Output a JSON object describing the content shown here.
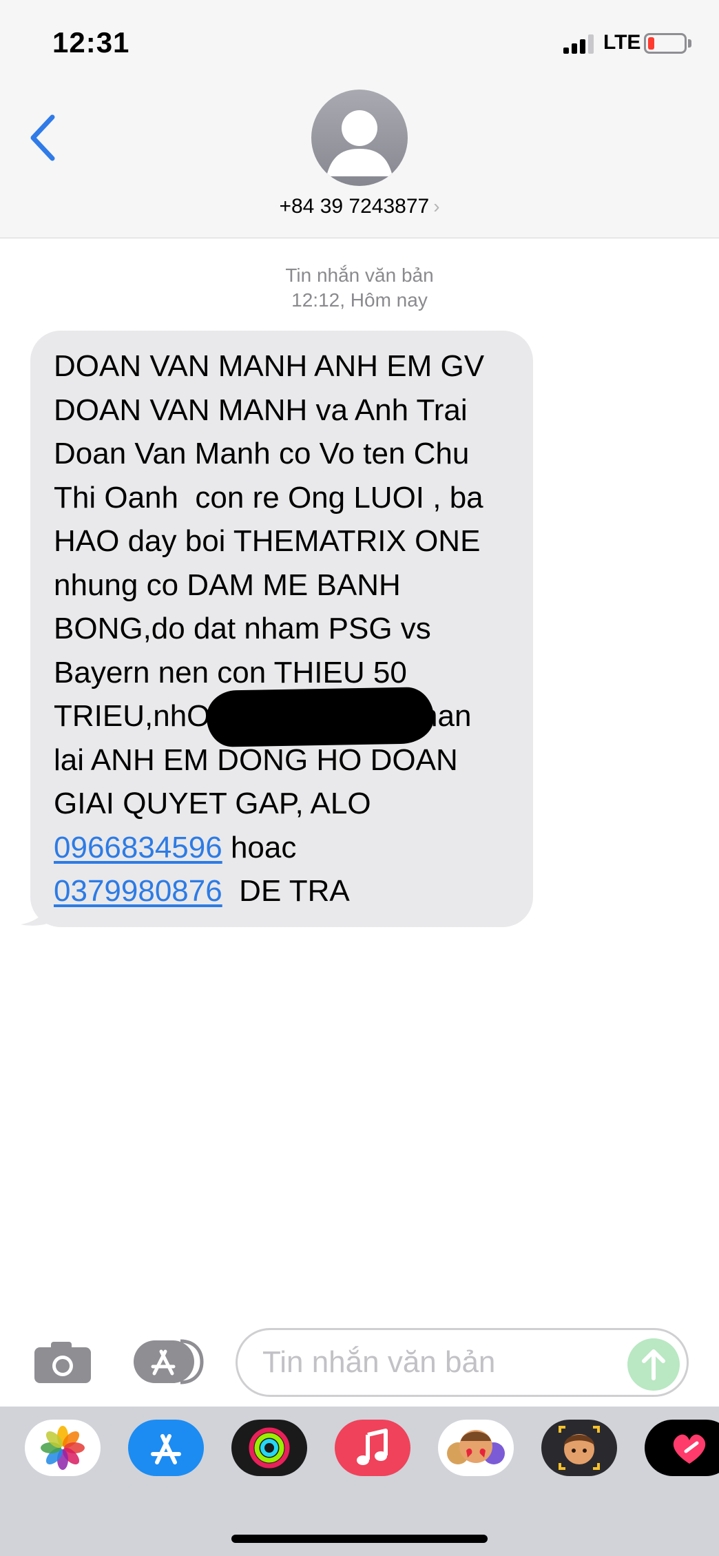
{
  "status_bar": {
    "time": "12:31",
    "network": "LTE"
  },
  "header": {
    "contact": "+84 39 7243877",
    "chevron": "›"
  },
  "conversation": {
    "service_label": "Tin nhắn văn bản",
    "timestamp": "12:12, Hôm nay",
    "message": {
      "lines": [
        "DOAN VAN MANH ANH EM GV",
        "DOAN VAN MANH va Anh Trai",
        "Doan Van Manh co Vo ten Chu",
        "Thi Oanh  con re Ong LUOI , ba",
        "HAO day boi THEMATRIX ONE",
        "nhung co DAM ME BANH",
        "BONG,do dat nham PSG vs",
        "Bayern nen con THIEU 50",
        "TRIEU,nhO                       nhan",
        "lai ANH EM DONG HO DOAN",
        "GIAI QUYET GAP, ALO"
      ],
      "phone_1": "0966834596",
      "connector": " hoac",
      "phone_2": "0379980876",
      "ending": "  DE TRA"
    }
  },
  "input_bar": {
    "placeholder": "Tin nhắn văn bản"
  },
  "app_drawer": {
    "apps": [
      "photos",
      "app-store",
      "activity",
      "music",
      "memoji-stickers",
      "memoji",
      "digital-touch"
    ]
  },
  "colors": {
    "link": "#2d7be5",
    "bubble": "#e9e9eb",
    "back": "#2f7be8",
    "send": "#b9e8c3"
  }
}
